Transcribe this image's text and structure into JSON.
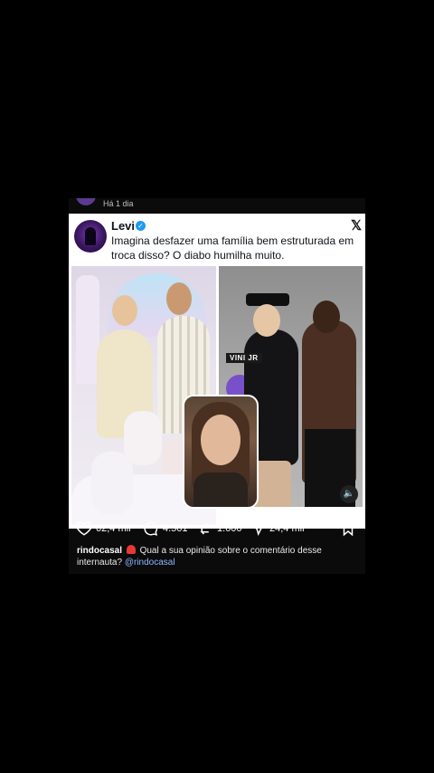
{
  "post": {
    "time": "Há 1 dia",
    "author": {
      "name": "Levi"
    },
    "tweet_text": "Imagina desfazer uma família bem estruturada em troca disso? O diabo humilha muito.",
    "image_tag": "VINI JR"
  },
  "actions": {
    "likes": "62,4 mil",
    "comments": "4.501",
    "reposts": "1.600",
    "shares": "24,4 mil"
  },
  "caption": {
    "user": "rindocasal",
    "text": "Qual a sua opinião sobre o comentário desse internauta?",
    "mention": "@rindocasal"
  },
  "icons": [
    "like-icon",
    "comment-icon",
    "repost-icon",
    "share-icon",
    "bookmark-icon",
    "verified-icon",
    "x-logo-icon",
    "mute-icon",
    "siren-icon"
  ]
}
